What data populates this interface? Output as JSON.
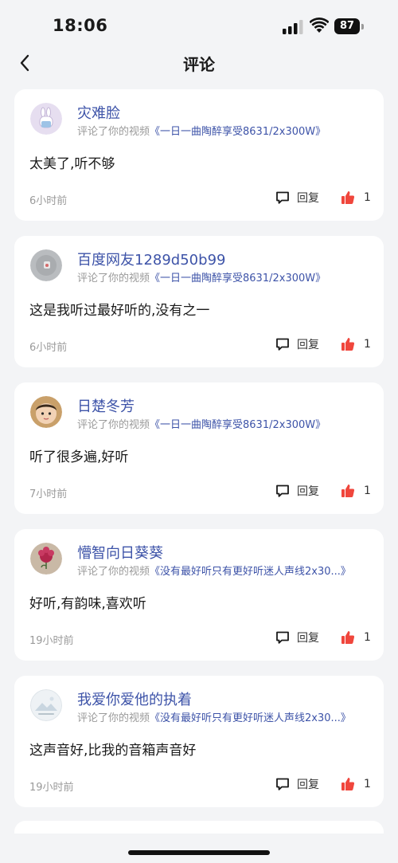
{
  "status_bar": {
    "time": "18:06",
    "battery": "87"
  },
  "nav": {
    "title": "评论"
  },
  "comments": [
    {
      "author": "灾难脸",
      "meta_prefix": "评论了你的视频",
      "video_title": "《一日一曲陶醉享受8631/2x300W》",
      "text": "太美了,听不够",
      "time": "6小时前",
      "reply_label": "回复",
      "likes": "1",
      "avatar_color": "#e6def0"
    },
    {
      "author": "百度网友1289d50b99",
      "meta_prefix": "评论了你的视频",
      "video_title": "《一日一曲陶醉享受8631/2x300W》",
      "text": "这是我听过最好听的,没有之一",
      "time": "6小时前",
      "reply_label": "回复",
      "likes": "1",
      "avatar_color": "#b9bcbf"
    },
    {
      "author": "日楚冬芳",
      "meta_prefix": "评论了你的视频",
      "video_title": "《一日一曲陶醉享受8631/2x300W》",
      "text": "听了很多遍,好听",
      "time": "7小时前",
      "reply_label": "回复",
      "likes": "1",
      "avatar_color": "#c9a06a"
    },
    {
      "author": "懵智向日葵葵",
      "meta_prefix": "评论了你的视频",
      "video_title": "《没有最好听只有更好听迷人声线2x30...》",
      "text": "好听,有韵味,喜欢听",
      "time": "19小时前",
      "reply_label": "回复",
      "likes": "1",
      "avatar_color": "#c9b9a6"
    },
    {
      "author": "我爱你爱他的执着",
      "meta_prefix": "评论了你的视频",
      "video_title": "《没有最好听只有更好听迷人声线2x30...》",
      "text": "这声音好,比我的音箱声音好",
      "time": "19小时前",
      "reply_label": "回复",
      "likes": "1",
      "avatar_color": "#dfe6ec"
    }
  ],
  "colors": {
    "link": "#3d53a8",
    "like": "#f0463c",
    "background": "#f3f4f6"
  }
}
